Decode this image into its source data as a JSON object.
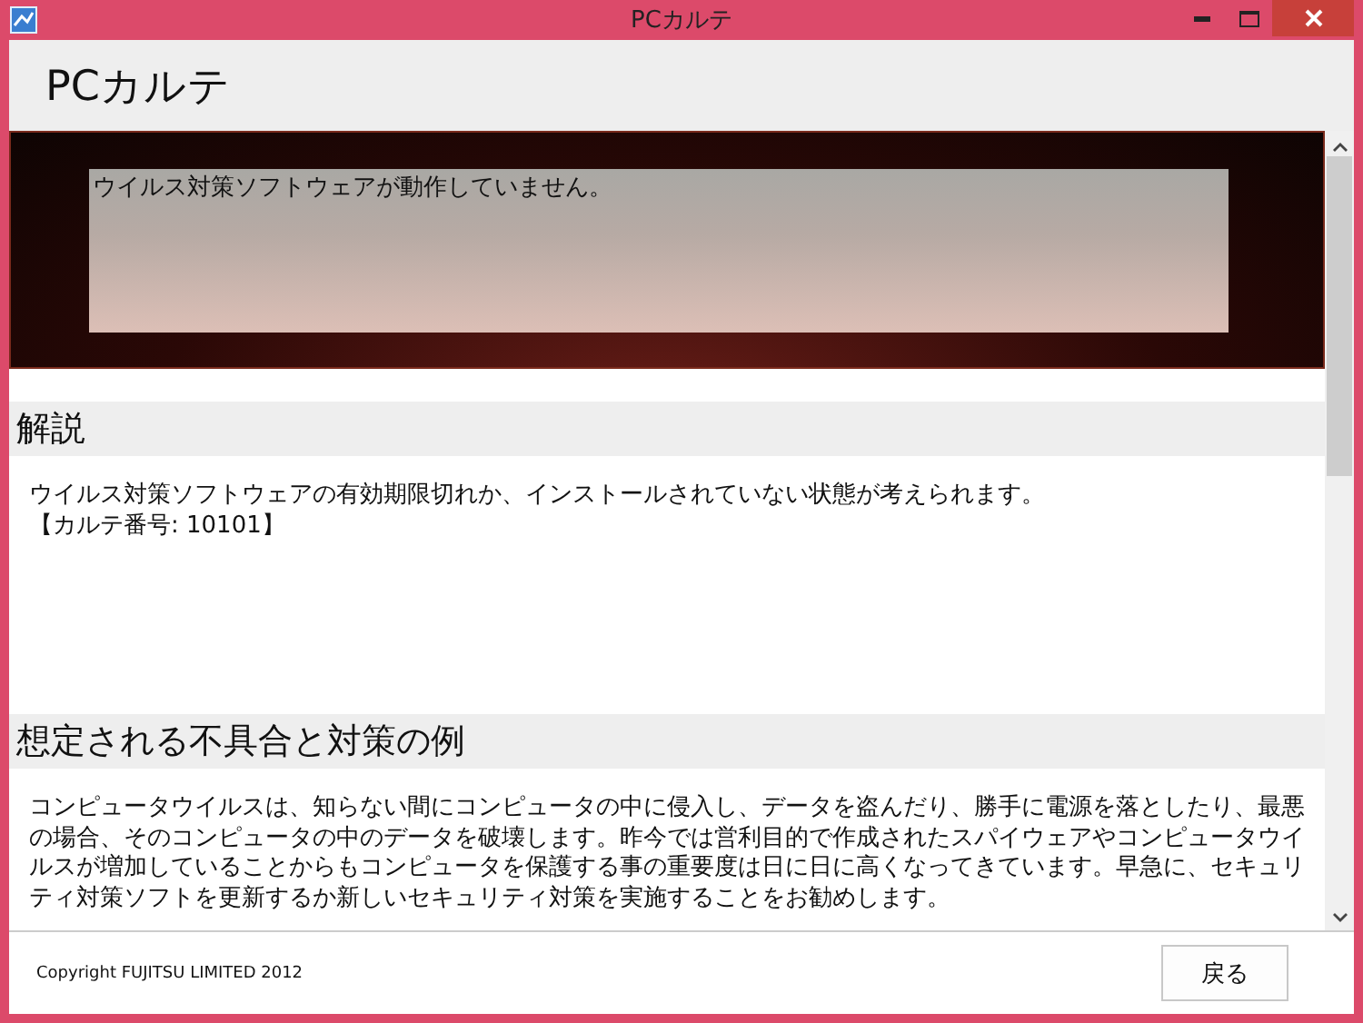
{
  "window": {
    "title": "PCカルテ"
  },
  "header": {
    "title": "PCカルテ"
  },
  "alert": {
    "message": "ウイルス対策ソフトウェアが動作していません。"
  },
  "sections": [
    {
      "heading": "解説",
      "paragraphs": [
        "ウイルス対策ソフトウェアの有効期限切れか、インストールされていない状態が考えられます。",
        "【カルテ番号: 10101】"
      ]
    },
    {
      "heading": "想定される不具合と対策の例",
      "paragraphs": [
        "コンピュータウイルスは、知らない間にコンピュータの中に侵入し、データを盗んだり、勝手に電源を落としたり、最悪の場合、そのコンピュータの中のデータを破壊します。昨今では営利目的で作成されたスパイウェアやコンピュータウイルスが増加していることからもコンピュータを保護する事の重要度は日に日に高くなってきています。早急に、セキュリティ対策ソフトを更新するか新しいセキュリティ対策を実施することをお勧めします。"
      ]
    }
  ],
  "footer": {
    "copyright": "Copyright FUJITSU LIMITED 2012",
    "back_button": "戻る"
  }
}
